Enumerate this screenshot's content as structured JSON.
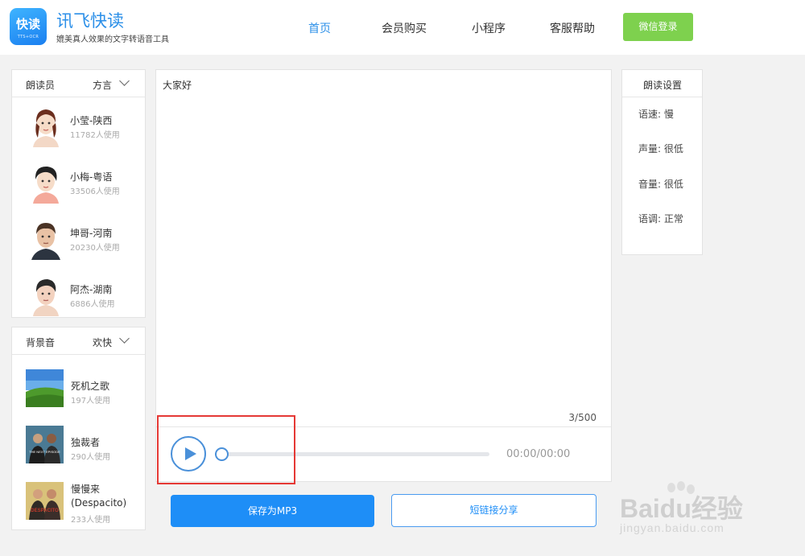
{
  "header": {
    "logo_text": "快读",
    "logo_sub": "TTS+OCR",
    "brand": "讯飞快读",
    "slogan": "媲美真人效果的文字转语音工具",
    "nav": [
      "首页",
      "会员购买",
      "小程序",
      "客服帮助"
    ],
    "login": "微信登录",
    "accent": "#2b8fe8",
    "login_color": "#7ed14e"
  },
  "readers": {
    "title": "朗读员",
    "filter": "方言",
    "items": [
      {
        "name": "小莹-陕西",
        "usage": "11782人使用"
      },
      {
        "name": "小梅-粤语",
        "usage": "33506人使用"
      },
      {
        "name": "坤哥-河南",
        "usage": "20230人使用"
      },
      {
        "name": "阿杰-湖南",
        "usage": "6886人使用"
      }
    ]
  },
  "bgm": {
    "title": "背景音",
    "filter": "欢快",
    "items": [
      {
        "name": "死机之歌",
        "usage": "197人使用"
      },
      {
        "name": "独裁者",
        "usage": "290人使用"
      },
      {
        "name": "慢慢来",
        "name2": "(Despacito)",
        "usage": "233人使用"
      }
    ],
    "cover_text_2": "THE NEXT EPISODE",
    "cover_text_3": "DESPACITO"
  },
  "editor": {
    "text": "大家好",
    "counter": "3/500",
    "time": "00:00/00:00",
    "progress": 0
  },
  "actions": {
    "save": "保存为MP3",
    "share": "短链接分享",
    "primary_color": "#1e8ef7"
  },
  "settings": {
    "title": "朗读设置",
    "items": [
      "语速: 慢",
      "声量: 很低",
      "音量: 很低",
      "语调: 正常"
    ]
  },
  "watermark": {
    "brand": "Baidu经验",
    "url": "jingyan.baidu.com"
  }
}
